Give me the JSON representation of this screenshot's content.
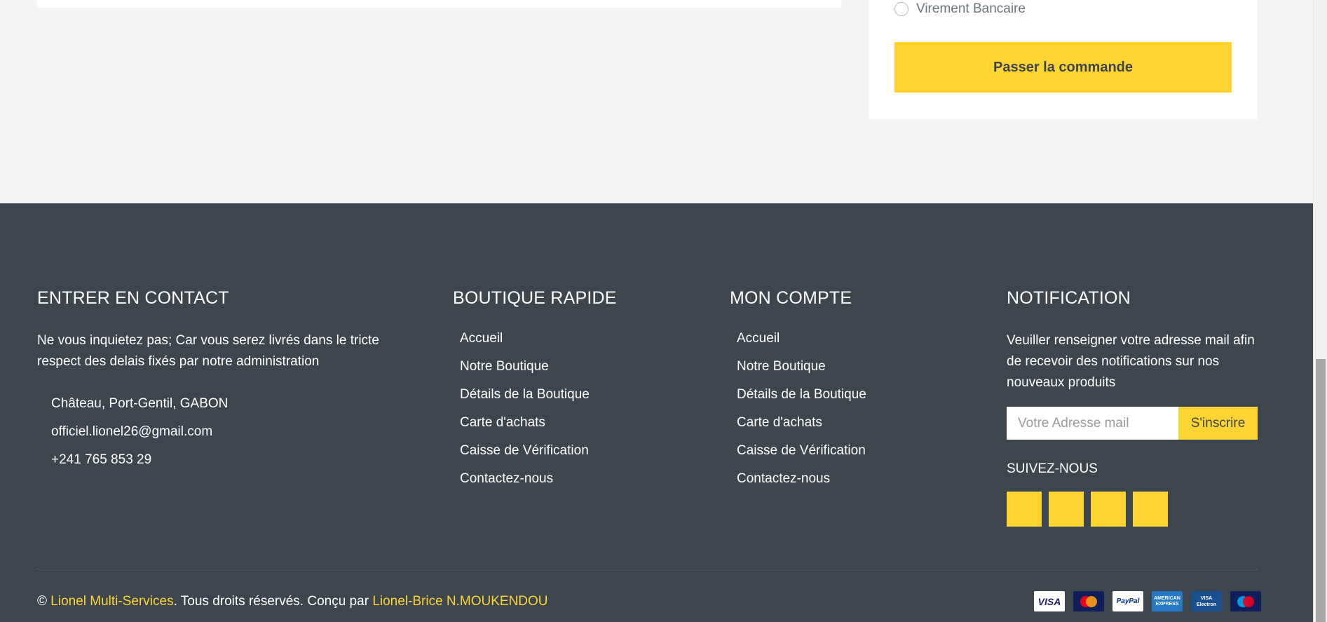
{
  "checkout": {
    "payment_option_label": "Virement Bancaire",
    "order_button_label": "Passer la commande"
  },
  "footer": {
    "contact": {
      "title": "ENTRER EN CONTACT",
      "description": "Ne vous inquietez pas; Car vous serez livrés dans le tricte respect des delais fixés par notre administration",
      "address": "Château, Port-Gentil, GABON",
      "email": "officiel.lionel26@gmail.com",
      "phone": "+241 765 853 29"
    },
    "quick_shop": {
      "title": "BOUTIQUE RAPIDE",
      "links": [
        "Accueil",
        "Notre Boutique",
        "Détails de la Boutique",
        "Carte d'achats",
        "Caisse de Vérification",
        "Contactez-nous"
      ]
    },
    "account": {
      "title": "MON COMPTE",
      "links": [
        "Accueil",
        "Notre Boutique",
        "Détails de la Boutique",
        "Carte d'achats",
        "Caisse de Vérification",
        "Contactez-nous"
      ]
    },
    "notification": {
      "title": "NOTIFICATION",
      "description": "Veuiller renseigner votre adresse mail afin de recevoir des notifications sur nos nouveaux produits",
      "email_placeholder": "Votre Adresse mail",
      "email_value": "",
      "subscribe_label": "S'inscrire",
      "follow_title": "SUIVEZ-NOUS",
      "social_icons": [
        "twitter-icon",
        "facebook-icon",
        "linkedin-icon",
        "instagram-icon"
      ]
    },
    "copyright": {
      "prefix": "© ",
      "company": "Lionel Multi-Services",
      "middle": ". Tous droits réservés. Conçu par ",
      "designer": "Lionel-Brice N.MOUKENDOU"
    },
    "payments": {
      "visa": "VISA",
      "paypal": "PayPal",
      "amex": "AMERICAN EXPRESS",
      "electron": "VISA Electron"
    }
  },
  "colors": {
    "accent": "#fed433",
    "footer_bg": "#3d464d",
    "page_bg": "#f4f4f4"
  }
}
